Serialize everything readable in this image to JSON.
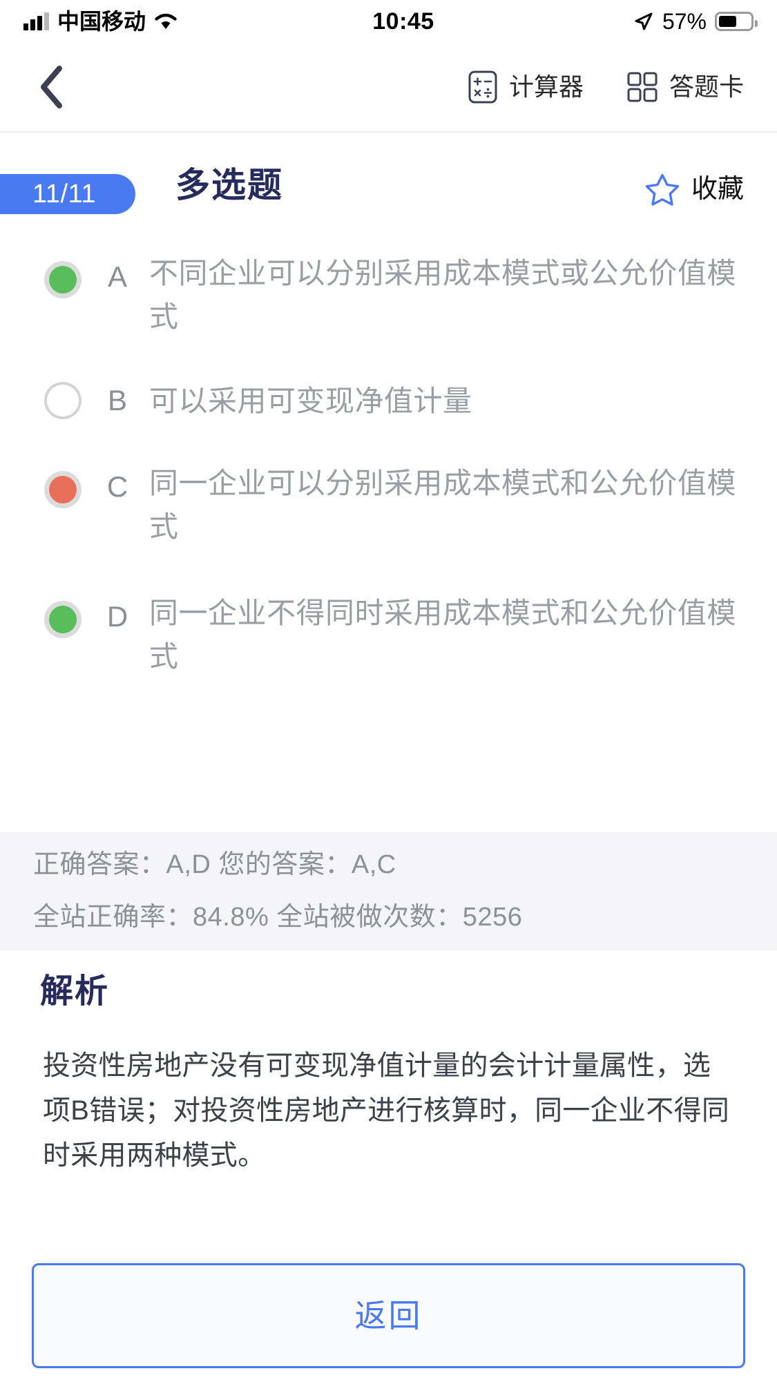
{
  "status_bar": {
    "carrier": "中国移动",
    "time": "10:45",
    "battery_percent": "57%",
    "signal_icon": "signal-bars-icon",
    "wifi_icon": "wifi-icon",
    "location_icon": "location-arrow-icon",
    "battery_icon": "battery-icon"
  },
  "nav_bar": {
    "back_icon": "chevron-left-icon",
    "calculator": {
      "label": "计算器",
      "icon": "calculator-icon"
    },
    "answer_sheet": {
      "label": "答题卡",
      "icon": "grid-icon"
    }
  },
  "question_header": {
    "progress": "11/11",
    "type": "多选题",
    "favorite": {
      "label": "收藏",
      "icon": "star-outline-icon"
    }
  },
  "options": [
    {
      "letter": "A",
      "text": "不同企业可以分别采用成本模式或公允价值模式",
      "state": "correct",
      "marker_color": "#58bd5b"
    },
    {
      "letter": "B",
      "text": "可以采用可变现净值计量",
      "state": "unselected",
      "marker_color": ""
    },
    {
      "letter": "C",
      "text": "同一企业可以分别采用成本模式和公允价值模式",
      "state": "wrong",
      "marker_color": "#e8705a"
    },
    {
      "letter": "D",
      "text": "同一企业不得同时采用成本模式和公允价值模式",
      "state": "correct",
      "marker_color": "#58bd5b"
    }
  ],
  "answer_block": {
    "line1": "正确答案：A,D 您的答案：A,C",
    "line2": "全站正确率：84.8% 全站被做次数：5256",
    "correct_answer": "A,D",
    "your_answer": "A,C",
    "accuracy": "84.8%",
    "attempts": "5256"
  },
  "analysis": {
    "title": "解析",
    "body": "投资性房地产没有可变现净值计量的会计计量属性，选项B错误；对投资性房地产进行核算时，同一企业不得同时采用两种模式。"
  },
  "footer": {
    "back_label": "返回"
  },
  "colors": {
    "accent_blue": "#4a7af2",
    "title_navy": "#262b5c",
    "correct_green": "#58bd5b",
    "wrong_red": "#e8705a",
    "muted_gray": "#9a9ea3",
    "panel_gray": "#f5f5f7"
  }
}
